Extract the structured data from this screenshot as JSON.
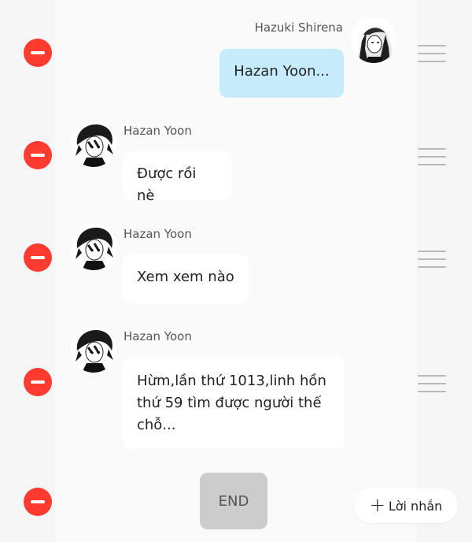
{
  "messages": [
    {
      "sender": "Hazuki Shirena",
      "text": "Hazan Yoon...",
      "mine": true
    },
    {
      "sender": "Hazan Yoon",
      "text": "Được rồi nè",
      "mine": false
    },
    {
      "sender": "Hazan Yoon",
      "text": "Xem xem nào",
      "mine": false
    },
    {
      "sender": "Hazan Yoon",
      "text_lines": [
        "Hừm,lần thứ 1013,linh hồn",
        "thứ 59 tìm được người thế",
        "chỗ..."
      ],
      "mine": false
    }
  ],
  "end_button": {
    "label": "END"
  },
  "add_message_button": {
    "icon": "plus-icon",
    "plus": "+",
    "label": "Lời nhắn"
  },
  "colors": {
    "delete": "#ff3b30",
    "my_bubble": "#c6ebfb",
    "other_bubble": "#ffffff",
    "end_button_bg": "#cccccc"
  }
}
